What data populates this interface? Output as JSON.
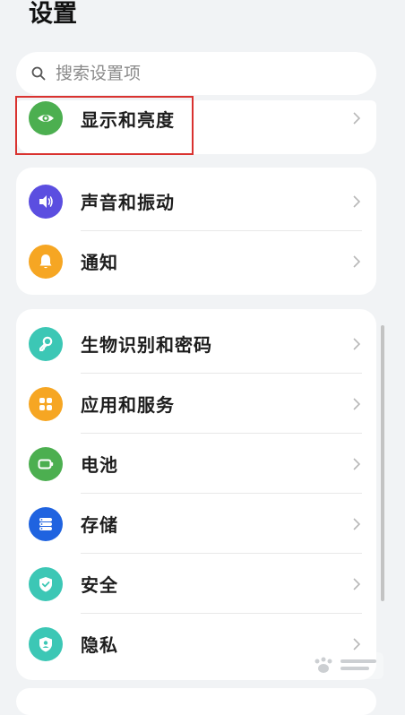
{
  "header": {
    "title": "设置"
  },
  "search": {
    "placeholder": "搜索设置项"
  },
  "groups": {
    "display": {
      "items": [
        {
          "label": "显示和亮度",
          "icon": "eye-icon",
          "color": "#4caf50"
        }
      ]
    },
    "sound": {
      "items": [
        {
          "label": "声音和振动",
          "icon": "speaker-icon",
          "color": "#5b4ee0"
        },
        {
          "label": "通知",
          "icon": "bell-icon",
          "color": "#f6a623"
        }
      ]
    },
    "main": {
      "items": [
        {
          "label": "生物识别和密码",
          "icon": "key-icon",
          "color": "#3cc7b5"
        },
        {
          "label": "应用和服务",
          "icon": "apps-grid-icon",
          "color": "#f6a623"
        },
        {
          "label": "电池",
          "icon": "battery-icon",
          "color": "#4caf50"
        },
        {
          "label": "存储",
          "icon": "storage-icon",
          "color": "#1f63e0"
        },
        {
          "label": "安全",
          "icon": "shield-check-icon",
          "color": "#3cc7b5"
        },
        {
          "label": "隐私",
          "icon": "privacy-shield-icon",
          "color": "#3cc7b5"
        }
      ]
    }
  },
  "colors": {
    "highlight": "#d9322f",
    "background": "#f1f3f5"
  }
}
